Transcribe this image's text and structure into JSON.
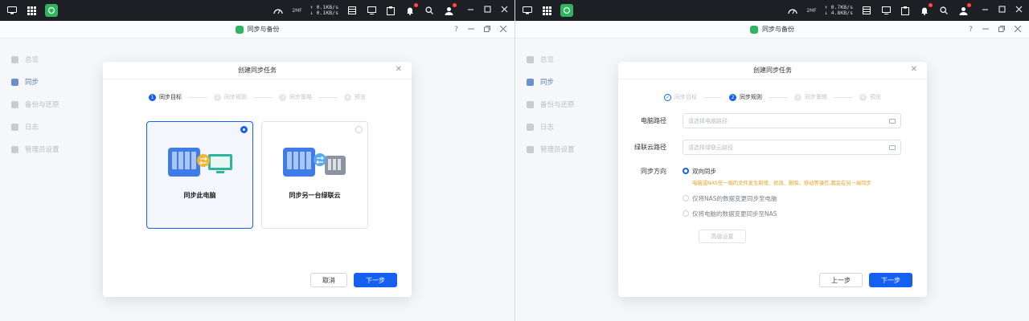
{
  "taskbar": {
    "net_up": "↑ 0.1KB/s",
    "net_down": "↓ 0.1KB/s",
    "net_up_r": "↑ 0.7KB/s",
    "net_down_r": "↓ 4.8KB/s",
    "net_label": "2MF"
  },
  "app": {
    "title": "同步与备份",
    "help": "?"
  },
  "sidebar": {
    "items": [
      {
        "label": "总览"
      },
      {
        "label": "同步"
      },
      {
        "label": "备份与还原"
      },
      {
        "label": "日志"
      },
      {
        "label": "管理员设置"
      }
    ]
  },
  "dialog": {
    "title": "创建同步任务",
    "steps": [
      {
        "num": "1",
        "label": "同步目标"
      },
      {
        "num": "2",
        "label": "同步规则"
      },
      {
        "num": "3",
        "label": "同步策略"
      },
      {
        "num": "4",
        "label": "预览"
      }
    ]
  },
  "left": {
    "cards": [
      {
        "label": "同步此电脑"
      },
      {
        "label": "同步另一台绿联云"
      }
    ],
    "cancel": "取消",
    "next": "下一步"
  },
  "right": {
    "pc_path_label": "电脑路径",
    "pc_path_placeholder": "请选择电脑路径",
    "nas_path_label": "绿联云路径",
    "nas_path_placeholder": "请选择绿联云路径",
    "direction_label": "同步方向",
    "options": [
      {
        "label": "双向同步"
      },
      {
        "label": "仅将NAS的数据变更同步至电脑"
      },
      {
        "label": "仅将电脑的数据变更同步至NAS"
      }
    ],
    "hint": "电脑或NAS任一端的文件发生新增、修改、删除、移动等操作,都会在另一端同步",
    "advanced": "高级设置",
    "prev": "上一步",
    "next": "下一步"
  },
  "colors": {
    "primary": "#1560f0",
    "warning": "#f0a020"
  }
}
